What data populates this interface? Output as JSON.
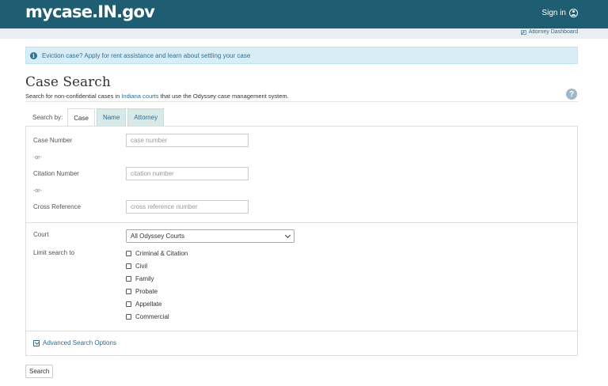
{
  "header": {
    "brand": "mycase.IN.gov",
    "signin_label": "Sign in"
  },
  "subbar": {
    "attorney_dashboard": "Attorney Dashboard"
  },
  "alert": {
    "text": "Eviction case? Apply for rent assistance and learn about settling your case"
  },
  "page": {
    "title": "Case Search",
    "subtitle_before": "Search for non-confidential cases in ",
    "subtitle_link": "Indiana courts",
    "subtitle_after": " that use the Odyssey case management system."
  },
  "tabs": {
    "label": "Search by:",
    "items": [
      "Case",
      "Name",
      "Attorney"
    ],
    "active": "Case"
  },
  "form": {
    "case_number": {
      "label": "Case Number",
      "placeholder": "case number"
    },
    "or_1": "-or-",
    "citation_number": {
      "label": "Citation Number",
      "placeholder": "citation number"
    },
    "or_2": "-or-",
    "cross_reference": {
      "label": "Cross Reference",
      "placeholder": "cross reference number"
    },
    "court": {
      "label": "Court",
      "selected": "All Odyssey Courts"
    },
    "limit": {
      "label": "Limit search to",
      "options": [
        "Criminal & Citation",
        "Civil",
        "Family",
        "Probate",
        "Appellate",
        "Commercial"
      ]
    },
    "advanced_label": "Advanced Search Options"
  },
  "search_button": "Search",
  "colors": {
    "header": "#1f5d73",
    "link": "#2e6b8a",
    "alert_bg": "#d9edf7",
    "tab_bg": "#d8e9e7"
  }
}
